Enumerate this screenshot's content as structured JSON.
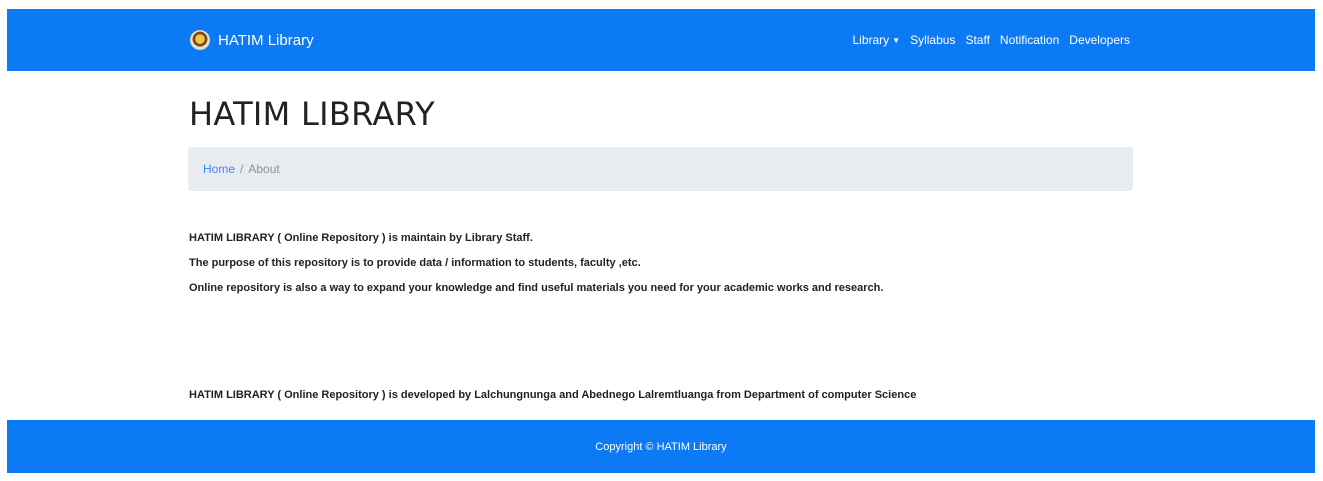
{
  "navbar": {
    "brand": "HATIM Library",
    "links": [
      {
        "label": "Library",
        "has_dropdown": true
      },
      {
        "label": "Syllabus"
      },
      {
        "label": "Staff"
      },
      {
        "label": "Notification"
      },
      {
        "label": "Developers"
      }
    ],
    "icons": {
      "logo": "library-logo-icon",
      "dropdown": "caret-down-icon"
    }
  },
  "page": {
    "title": "HATIM LIBRARY",
    "breadcrumb": {
      "home": "Home",
      "separator": "/",
      "current": "About"
    },
    "paragraphs": [
      "HATIM LIBRARY ( Online Repository ) is maintain by Library Staff.",
      "The purpose of this repository is to provide data / information to students, faculty ,etc.",
      "Online repository is also  a way to expand your knowledge and find useful materials you need for your academic works and research.",
      "HATIM LIBRARY ( Online Repository ) is developed by  Lalchungnunga and Abednego Lalremtluanga from Department of computer Science"
    ]
  },
  "footer": {
    "copyright": "Copyright © HATIM Library"
  },
  "colors": {
    "primary": "#0d7af5",
    "breadcrumb_bg": "#e9ecef",
    "link": "#3d8bf0",
    "text": "#222222"
  }
}
